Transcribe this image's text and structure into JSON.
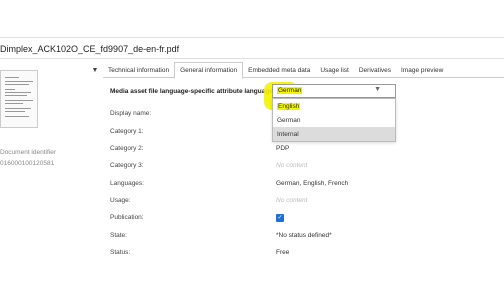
{
  "header": {
    "file_title": "Dimplex_ACK102O_CE_fd9907_de-en-fr.pdf"
  },
  "left_panel": {
    "identifier_label": "Document identifier",
    "identifier_value": "016000100120581"
  },
  "tabs": [
    {
      "label": "Technical information"
    },
    {
      "label": "General information"
    },
    {
      "label": "Embedded meta data"
    },
    {
      "label": "Usage list"
    },
    {
      "label": "Derivatives"
    },
    {
      "label": "Image preview"
    }
  ],
  "active_tab": "General information",
  "form": {
    "language_label": "Media asset file language-specific attribute languages",
    "language_select_value": "German",
    "language_options": [
      "English",
      "German",
      "Internal"
    ],
    "display_name_label": "Display name:",
    "category1_label": "Category 1:",
    "category2_label": "Category 2:",
    "category2_value": "PDP",
    "category3_label": "Category 3:",
    "category3_value": "No content",
    "languages_label": "Languages:",
    "languages_value": "German, English, French",
    "usage_label": "Usage:",
    "usage_value": "No content",
    "publication_label": "Publication:",
    "publication_checked": true,
    "state_label": "State:",
    "state_value": "*No status defined*",
    "status_label": "Status:",
    "status_value": "Free"
  },
  "icons": {
    "collapse": "chevron-down-icon",
    "select_caret": "triangle-down-icon",
    "checkbox": "checkmark-icon"
  },
  "colors": {
    "highlight": "#f3f500",
    "checkbox": "#1e6fd9"
  }
}
